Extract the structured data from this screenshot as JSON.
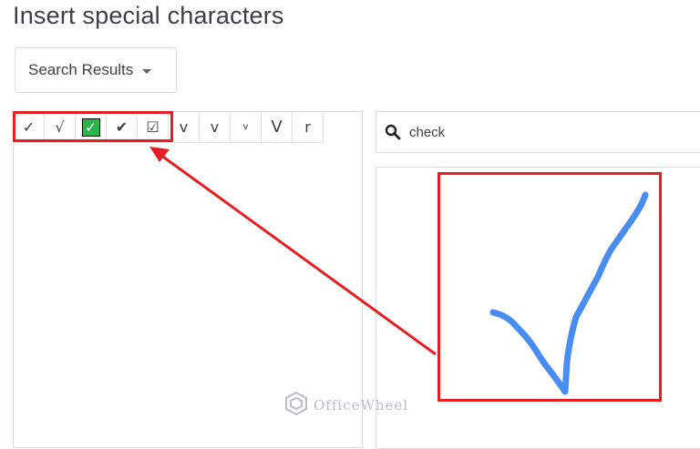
{
  "dialog": {
    "title": "Insert special characters"
  },
  "category_dropdown": {
    "selected": "Search Results"
  },
  "results": {
    "characters": [
      "✓",
      "√",
      "✅",
      "✔",
      "☑",
      "v",
      "v",
      "v",
      "V",
      "r"
    ]
  },
  "search": {
    "value": "check",
    "icon": "search-icon"
  },
  "drawing_area": {
    "stroke_color": "#4a8df0"
  },
  "annotations": {
    "highlight_color": "#e31e24"
  },
  "watermark": {
    "text": "OfficeWheel"
  }
}
